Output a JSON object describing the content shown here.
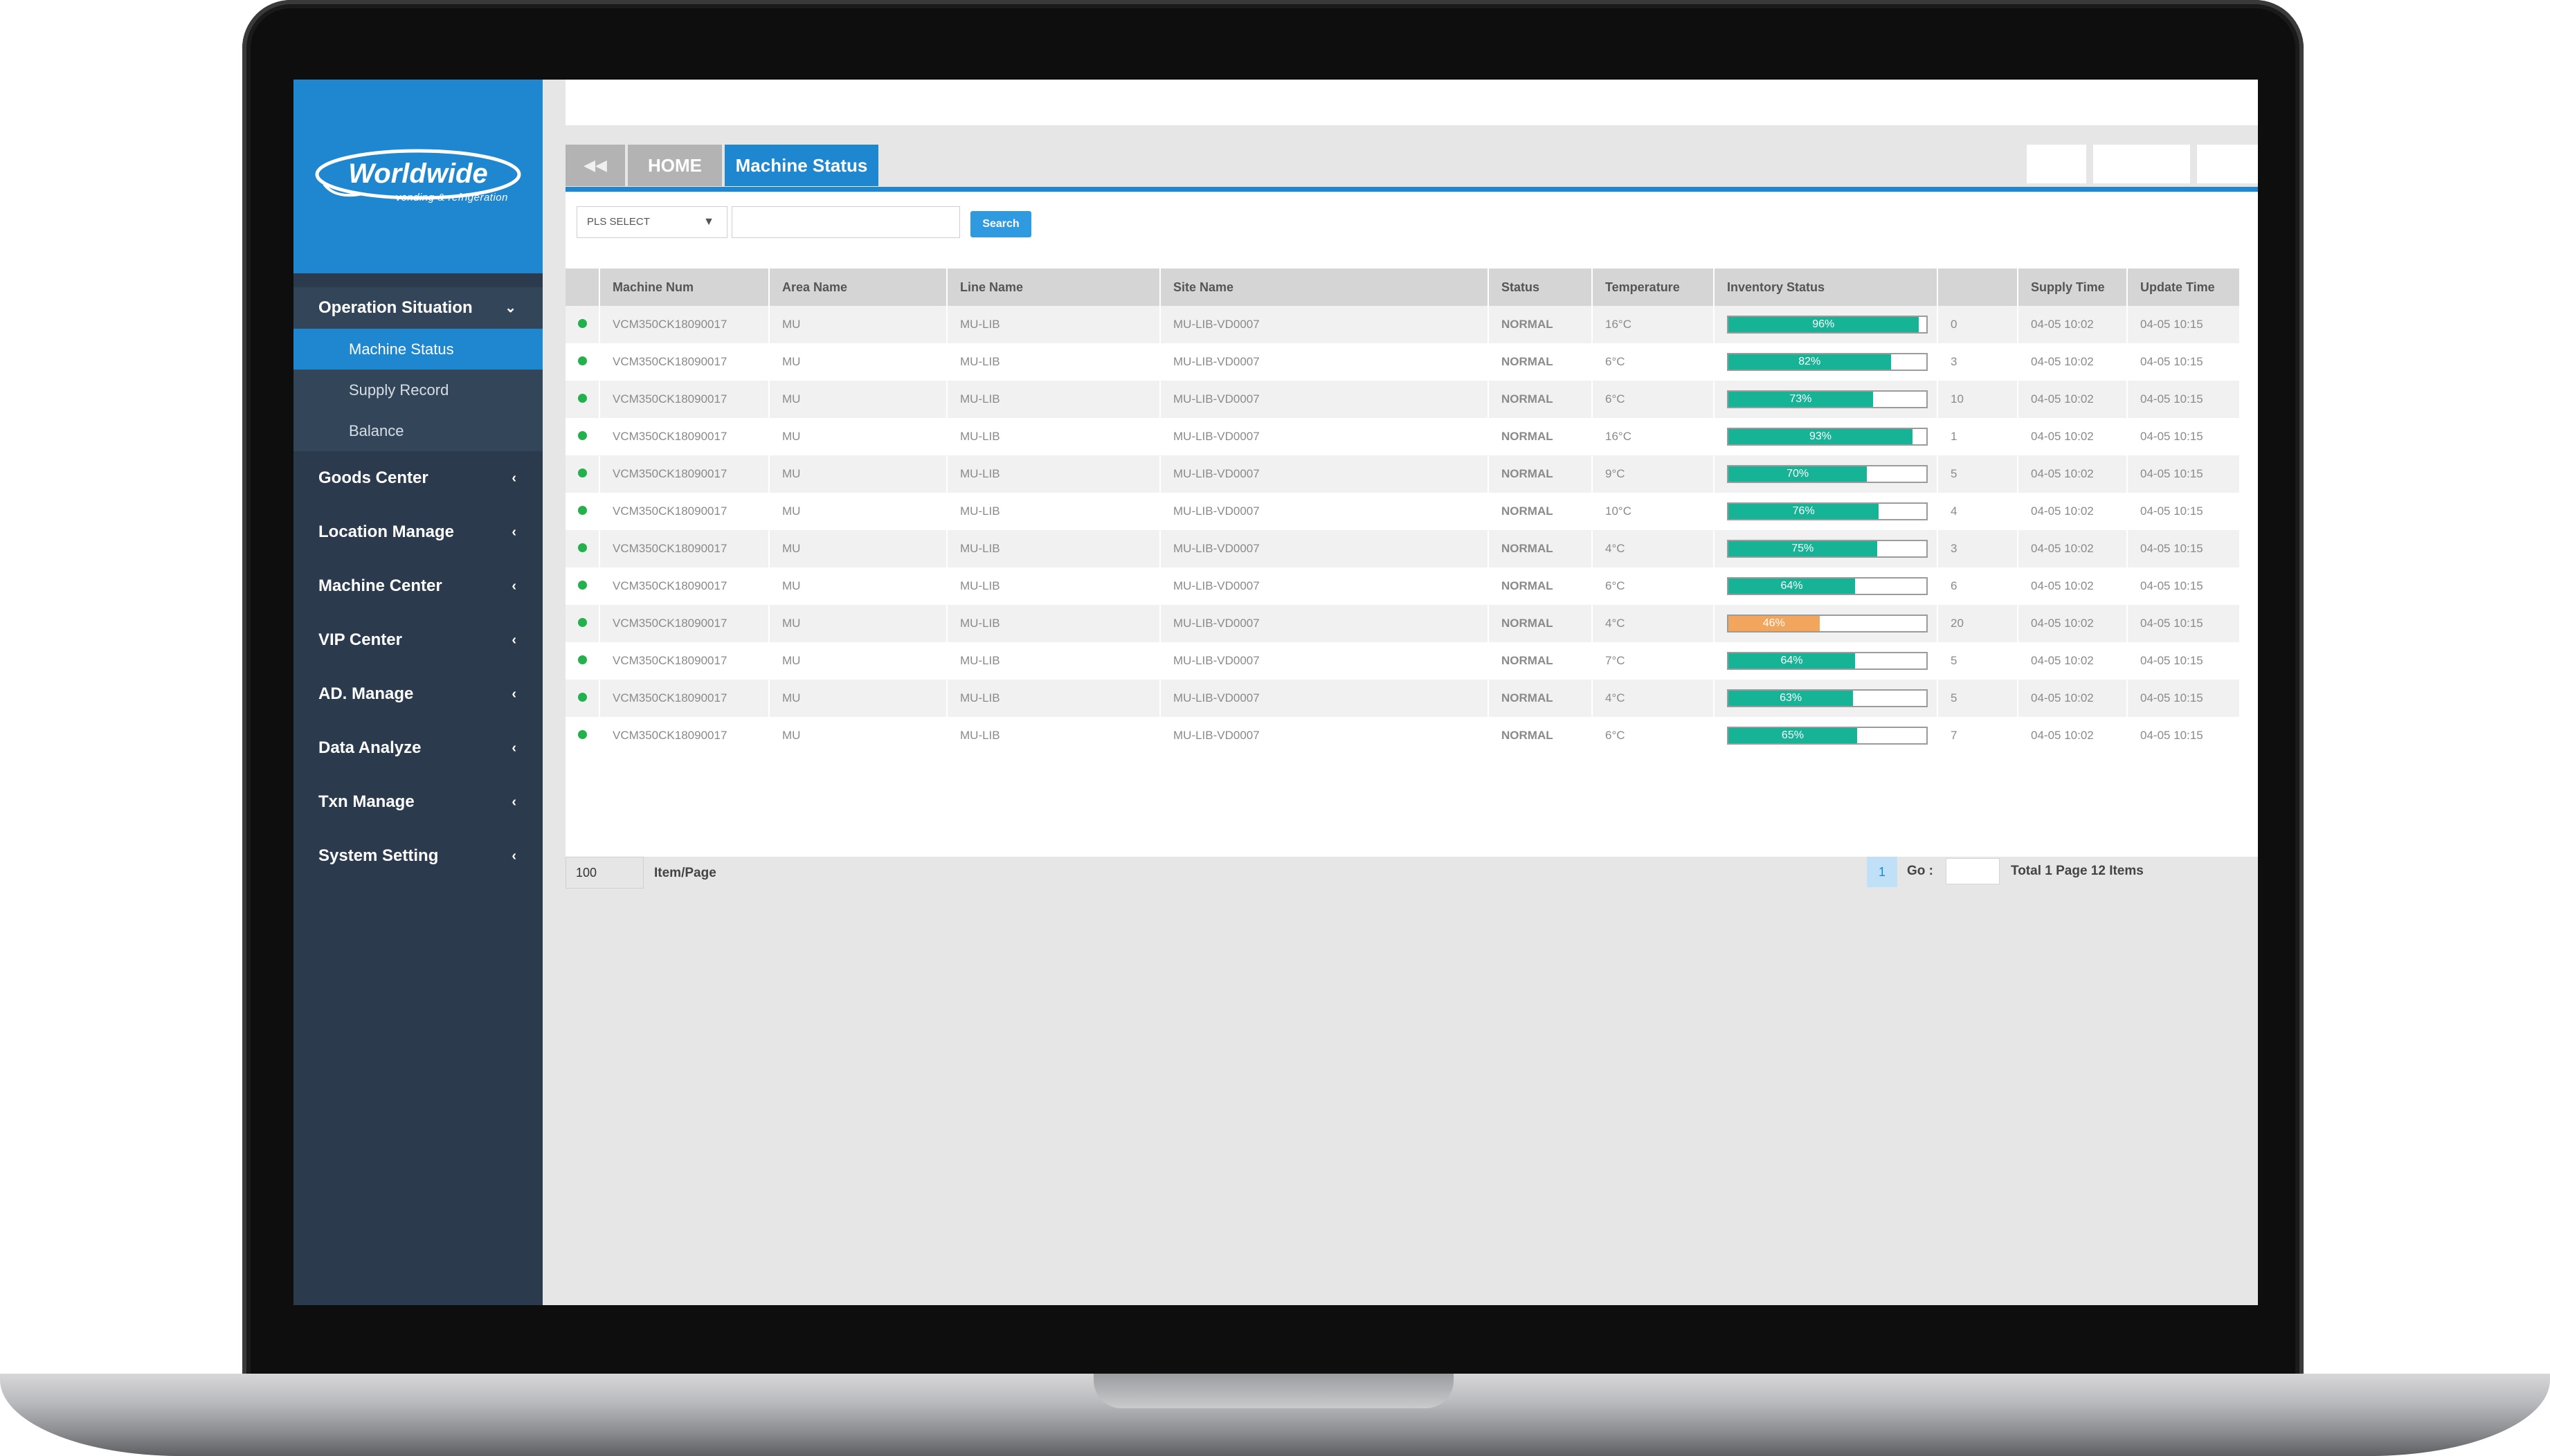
{
  "brand": {
    "logo_text": "Worldwide",
    "tagline": "vending & refrigeration",
    "primary_color": "#1f86d0",
    "sidebar_color": "#2b3b4d",
    "ok_color": "#22b14c",
    "bar_color": "#17b396",
    "warn_bar_color": "#f2a55c"
  },
  "sidebar": {
    "groups": [
      {
        "label": "Operation Situation",
        "icon": "chevron-down-icon",
        "open": true,
        "items": [
          {
            "label": "Machine Status",
            "active": true
          },
          {
            "label": "Supply Record",
            "active": false
          },
          {
            "label": "Balance",
            "active": false
          }
        ]
      },
      {
        "label": "Goods Center",
        "icon": "chevron-left-icon"
      },
      {
        "label": "Location Manage",
        "icon": "chevron-left-icon"
      },
      {
        "label": "Machine Center",
        "icon": "chevron-left-icon"
      },
      {
        "label": "VIP Center",
        "icon": "chevron-left-icon"
      },
      {
        "label": "AD. Manage",
        "icon": "chevron-left-icon"
      },
      {
        "label": "Data Analyze",
        "icon": "chevron-left-icon"
      },
      {
        "label": "Txn Manage",
        "icon": "chevron-left-icon"
      },
      {
        "label": "System Setting",
        "icon": "chevron-left-icon"
      }
    ]
  },
  "tabs": {
    "back_icon": "◀◀",
    "home": "HOME",
    "active": "Machine Status"
  },
  "filter": {
    "select_value": "PLS SELECT",
    "input_value": "",
    "search_label": "Search"
  },
  "table": {
    "columns": [
      "",
      "Machine Num",
      "Area Name",
      "Line Name",
      "Site Name",
      "Status",
      "Temperature",
      "Inventory Status",
      "",
      "Supply Time",
      "Update Time"
    ],
    "rows": [
      {
        "machine": "VCM350CK18090017",
        "area": "MU",
        "line": "MU-LIB",
        "site": "MU-LIB-VD0007",
        "status": "NORMAL",
        "temp": "16°C",
        "inventory": 96,
        "inventory_label": "96%",
        "count": "0",
        "supply": "04-05 10:02",
        "update": "04-05 10:15"
      },
      {
        "machine": "VCM350CK18090017",
        "area": "MU",
        "line": "MU-LIB",
        "site": "MU-LIB-VD0007",
        "status": "NORMAL",
        "temp": "6°C",
        "inventory": 82,
        "inventory_label": "82%",
        "count": "3",
        "supply": "04-05 10:02",
        "update": "04-05 10:15"
      },
      {
        "machine": "VCM350CK18090017",
        "area": "MU",
        "line": "MU-LIB",
        "site": "MU-LIB-VD0007",
        "status": "NORMAL",
        "temp": "6°C",
        "inventory": 73,
        "inventory_label": "73%",
        "count": "10",
        "supply": "04-05 10:02",
        "update": "04-05 10:15"
      },
      {
        "machine": "VCM350CK18090017",
        "area": "MU",
        "line": "MU-LIB",
        "site": "MU-LIB-VD0007",
        "status": "NORMAL",
        "temp": "16°C",
        "inventory": 93,
        "inventory_label": "93%",
        "count": "1",
        "supply": "04-05 10:02",
        "update": "04-05 10:15"
      },
      {
        "machine": "VCM350CK18090017",
        "area": "MU",
        "line": "MU-LIB",
        "site": "MU-LIB-VD0007",
        "status": "NORMAL",
        "temp": "9°C",
        "inventory": 70,
        "inventory_label": "70%",
        "count": "5",
        "supply": "04-05 10:02",
        "update": "04-05 10:15"
      },
      {
        "machine": "VCM350CK18090017",
        "area": "MU",
        "line": "MU-LIB",
        "site": "MU-LIB-VD0007",
        "status": "NORMAL",
        "temp": "10°C",
        "inventory": 76,
        "inventory_label": "76%",
        "count": "4",
        "supply": "04-05 10:02",
        "update": "04-05 10:15"
      },
      {
        "machine": "VCM350CK18090017",
        "area": "MU",
        "line": "MU-LIB",
        "site": "MU-LIB-VD0007",
        "status": "NORMAL",
        "temp": "4°C",
        "inventory": 75,
        "inventory_label": "75%",
        "count": "3",
        "supply": "04-05 10:02",
        "update": "04-05 10:15"
      },
      {
        "machine": "VCM350CK18090017",
        "area": "MU",
        "line": "MU-LIB",
        "site": "MU-LIB-VD0007",
        "status": "NORMAL",
        "temp": "6°C",
        "inventory": 64,
        "inventory_label": "64%",
        "count": "6",
        "supply": "04-05 10:02",
        "update": "04-05 10:15"
      },
      {
        "machine": "VCM350CK18090017",
        "area": "MU",
        "line": "MU-LIB",
        "site": "MU-LIB-VD0007",
        "status": "NORMAL",
        "temp": "4°C",
        "inventory": 46,
        "inventory_label": "46%",
        "count": "20",
        "supply": "04-05 10:02",
        "update": "04-05 10:15",
        "warn": true
      },
      {
        "machine": "VCM350CK18090017",
        "area": "MU",
        "line": "MU-LIB",
        "site": "MU-LIB-VD0007",
        "status": "NORMAL",
        "temp": "7°C",
        "inventory": 64,
        "inventory_label": "64%",
        "count": "5",
        "supply": "04-05 10:02",
        "update": "04-05 10:15"
      },
      {
        "machine": "VCM350CK18090017",
        "area": "MU",
        "line": "MU-LIB",
        "site": "MU-LIB-VD0007",
        "status": "NORMAL",
        "temp": "4°C",
        "inventory": 63,
        "inventory_label": "63%",
        "count": "5",
        "supply": "04-05 10:02",
        "update": "04-05 10:15"
      },
      {
        "machine": "VCM350CK18090017",
        "area": "MU",
        "line": "MU-LIB",
        "site": "MU-LIB-VD0007",
        "status": "NORMAL",
        "temp": "6°C",
        "inventory": 65,
        "inventory_label": "65%",
        "count": "7",
        "supply": "04-05 10:02",
        "update": "04-05 10:15"
      }
    ]
  },
  "pager": {
    "page_size": "100",
    "page_size_label": "Item/Page",
    "current_page": "1",
    "go_label": "Go :",
    "go_value": "",
    "total": "Total 1 Page 12 Items"
  }
}
